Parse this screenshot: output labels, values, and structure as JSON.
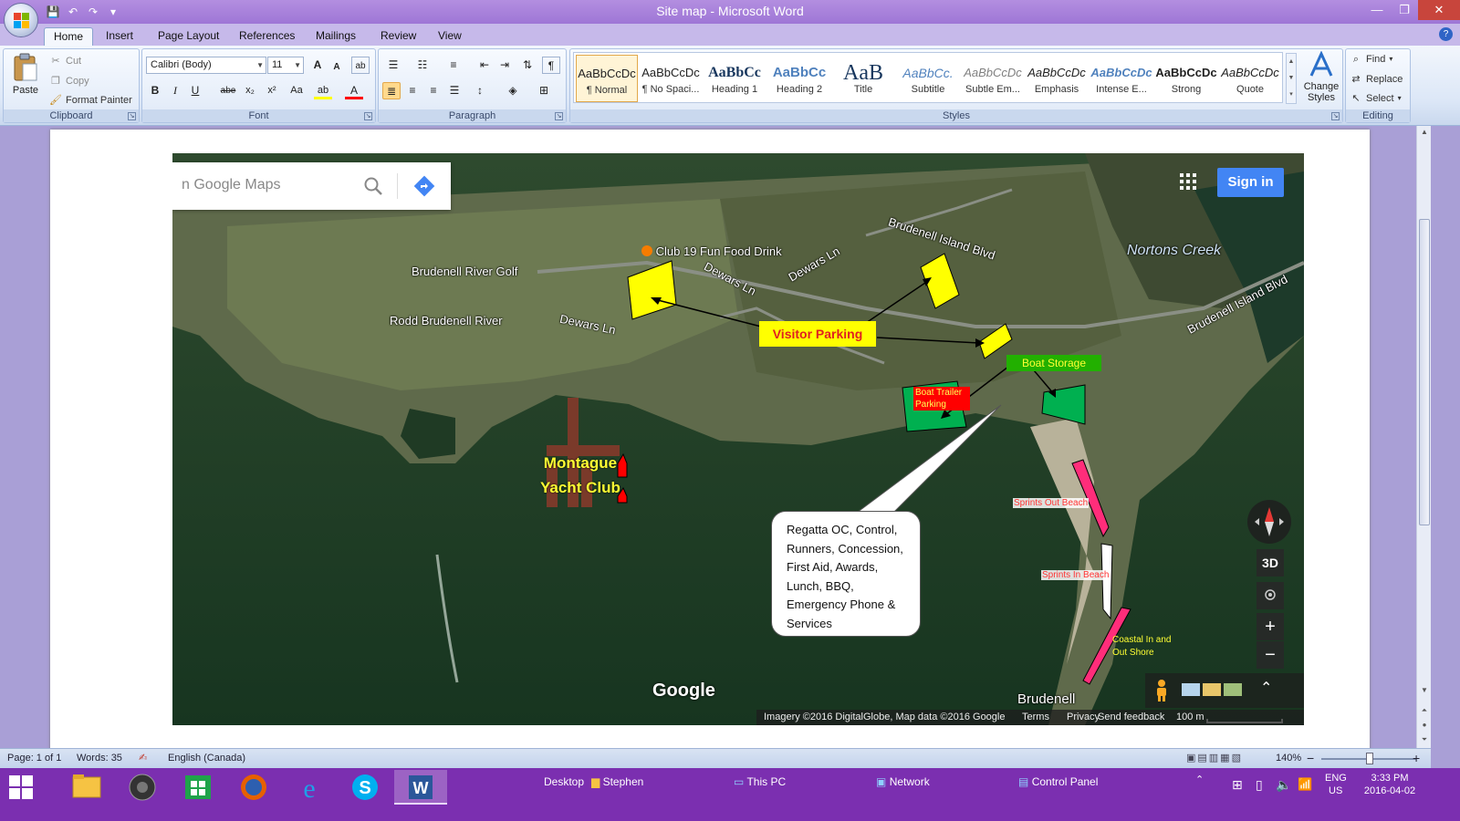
{
  "window": {
    "title": "Site map - Microsoft Word",
    "minimize_glyph": "—",
    "maximize_glyph": "❐",
    "close_glyph": "✕"
  },
  "qat": {
    "save": "💾",
    "undo": "↶",
    "redo": "↷",
    "more": "▾"
  },
  "ribbon": {
    "tabs": [
      "Home",
      "Insert",
      "Page Layout",
      "References",
      "Mailings",
      "Review",
      "View"
    ],
    "help": "?",
    "clipboard": {
      "group_label": "Clipboard",
      "paste": "Paste",
      "cut": "Cut",
      "copy": "Copy",
      "format_painter": "Format Painter"
    },
    "font": {
      "group_label": "Font",
      "font_name": "Calibri (Body)",
      "font_size": "11",
      "grow": "A",
      "shrink": "A",
      "clear": "ab",
      "bold": "B",
      "italic": "I",
      "underline": "U",
      "strike": "abe",
      "subscript": "x₂",
      "superscript": "x²",
      "change_case": "Aa",
      "highlight": "ab",
      "font_color": "A"
    },
    "paragraph": {
      "group_label": "Paragraph",
      "pilcrow": "¶"
    },
    "styles": {
      "group_label": "Styles",
      "items": [
        {
          "preview": "AaBbCcDc",
          "name": "¶ Normal"
        },
        {
          "preview": "AaBbCcDc",
          "name": "¶ No Spaci..."
        },
        {
          "preview": "AaBbCc",
          "name": "Heading 1"
        },
        {
          "preview": "AaBbCc",
          "name": "Heading 2"
        },
        {
          "preview": "AaB",
          "name": "Title"
        },
        {
          "preview": "AaBbCc.",
          "name": "Subtitle"
        },
        {
          "preview": "AaBbCcDc",
          "name": "Subtle Em..."
        },
        {
          "preview": "AaBbCcDc",
          "name": "Emphasis"
        },
        {
          "preview": "AaBbCcDc",
          "name": "Intense E..."
        },
        {
          "preview": "AaBbCcDc",
          "name": "Strong"
        },
        {
          "preview": "AaBbCcDc",
          "name": "Quote"
        }
      ],
      "change_styles": "Change Styles"
    },
    "editing": {
      "group_label": "Editing",
      "find": "Find",
      "replace": "Replace",
      "select": "Select"
    }
  },
  "map": {
    "search_placeholder": "n Google Maps",
    "sign_in": "Sign in",
    "labels": {
      "club19": "Club 19 Fun Food Drink",
      "golf": "Brudenell River Golf",
      "rodd": "Rodd Brudenell River",
      "dewars1": "Dewars Ln",
      "dewars2": "Dewars Ln",
      "dewars3": "Dewars Ln",
      "blvd1": "Brudenell Island Blvd",
      "blvd2": "Brudenell Island Blvd",
      "nortons": "Nortons Creek",
      "brudenell": "Brudenell"
    },
    "annotations": {
      "visitor_parking": "Visitor Parking",
      "boat_storage": "Boat Storage",
      "trailer_line1": "Boat Trailer",
      "trailer_line2": "Parking",
      "yacht_line1": "Montague",
      "yacht_line2": "Yacht Club",
      "sprints_out": "Sprints Out Beach",
      "sprints_in": "Sprints In Beach",
      "coastal_line1": "Coastal In and",
      "coastal_line2": "Out Shore",
      "callout_lines": [
        "Regatta OC, Control,",
        "Runners, Concession,",
        "First Aid, Awards,",
        "Lunch, BBQ,",
        "Emergency Phone &",
        "Services"
      ]
    },
    "controls": {
      "three_d": "3D",
      "zoom_in": "+",
      "zoom_out": "−",
      "expand": "⌃"
    },
    "google_logo": "Google",
    "footer": {
      "imagery": "Imagery ©2016 DigitalGlobe, Map data ©2016 Google",
      "terms": "Terms",
      "privacy": "Privacy",
      "feedback": "Send feedback",
      "scale": "100 m"
    }
  },
  "status": {
    "page": "Page: 1 of 1",
    "words": "Words: 35",
    "language": "English (Canada)",
    "zoom": "140%",
    "zoom_minus": "−",
    "zoom_plus": "+"
  },
  "taskbar": {
    "desktop": "Desktop",
    "stephen": "Stephen",
    "this_pc": "This PC",
    "network": "Network",
    "control_panel": "Control Panel",
    "lang1": "ENG",
    "lang2": "US",
    "time": "3:33 PM",
    "date": "2016-04-02"
  }
}
